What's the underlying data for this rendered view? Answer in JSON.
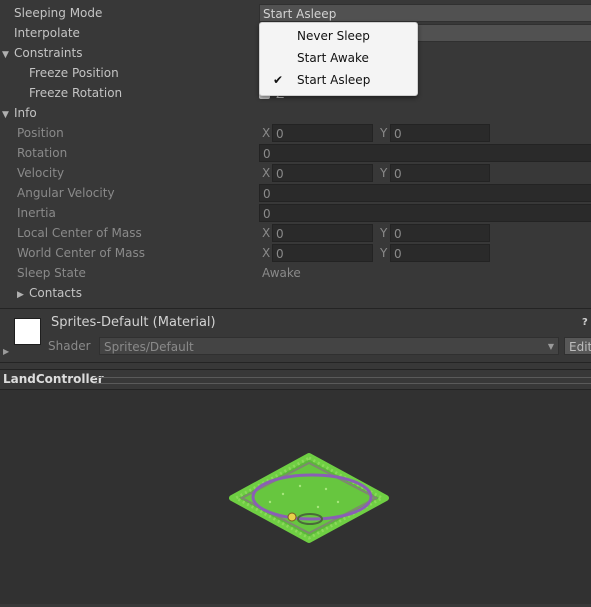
{
  "rows": {
    "sleeping_mode": {
      "label": "Sleeping Mode",
      "value": "Start Asleep"
    },
    "interpolate": {
      "label": "Interpolate"
    },
    "constraints": {
      "label": "Constraints"
    },
    "freeze_position": {
      "label": "Freeze Position"
    },
    "freeze_rotation": {
      "label": "Freeze Rotation",
      "axis": "Z"
    },
    "info": {
      "label": "Info"
    },
    "position": {
      "label": "Position",
      "x_axis": "X",
      "x": "0",
      "y_axis": "Y",
      "y": "0"
    },
    "rotation": {
      "label": "Rotation",
      "value": "0"
    },
    "velocity": {
      "label": "Velocity",
      "x_axis": "X",
      "x": "0",
      "y_axis": "Y",
      "y": "0"
    },
    "angular_velocity": {
      "label": "Angular Velocity",
      "value": "0"
    },
    "inertia": {
      "label": "Inertia",
      "value": "0"
    },
    "local_com": {
      "label": "Local Center of Mass",
      "x_axis": "X",
      "x": "0",
      "y_axis": "Y",
      "y": "0"
    },
    "world_com": {
      "label": "World Center of Mass",
      "x_axis": "X",
      "x": "0",
      "y_axis": "Y",
      "y": "0"
    },
    "sleep_state": {
      "label": "Sleep State",
      "value": "Awake"
    },
    "contacts": {
      "label": "Contacts"
    }
  },
  "dropdown": {
    "options": [
      "Never Sleep",
      "Start Awake",
      "Start Asleep"
    ],
    "selected": "Start Asleep"
  },
  "material": {
    "title": "Sprites-Default (Material)",
    "shader_label": "Shader",
    "shader_value": "Sprites/Default",
    "edit_label": "Edit"
  },
  "preview": {
    "title": "LandController"
  },
  "colors": {
    "background": "#383838",
    "preview_bg": "#313131",
    "grass": "#5cb83a",
    "grass_light": "#8ad85a",
    "path": "#8a5fb5",
    "tile": "#7d8a6e",
    "swatch": "#ffffff"
  },
  "icons": {
    "foldout_open": "triangle-down-icon",
    "foldout_closed": "triangle-right-icon",
    "check": "checkmark-icon",
    "help": "help-icon",
    "dropdown": "chevron-down-icon"
  }
}
